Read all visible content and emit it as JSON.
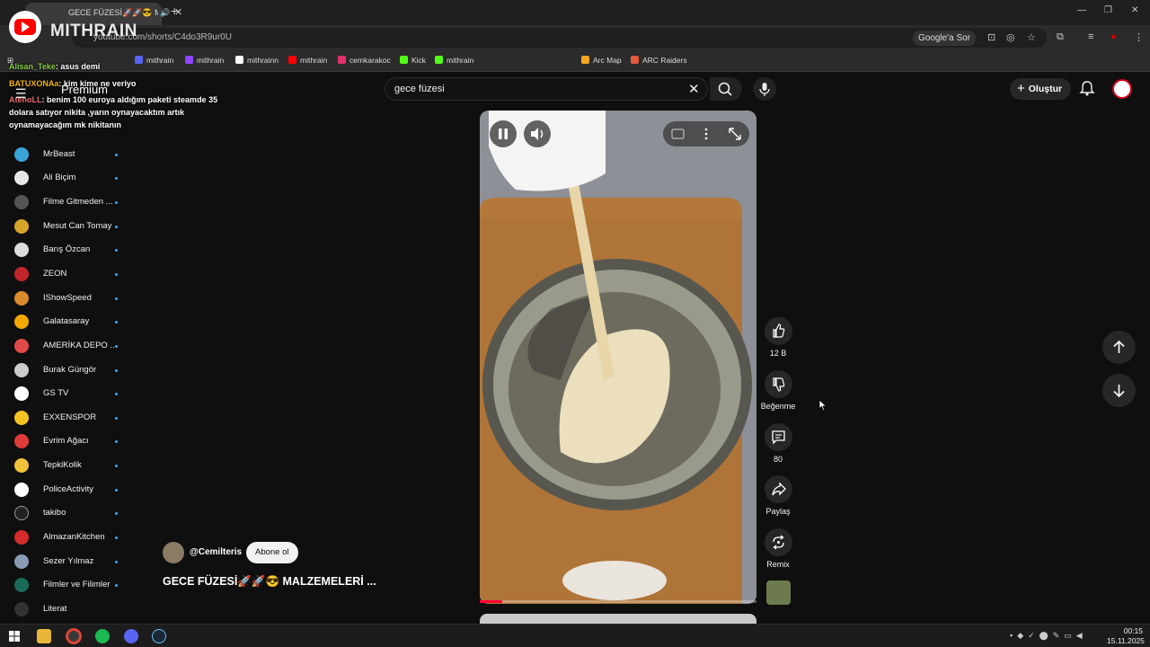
{
  "browser": {
    "tab_title": "GECE FÜZESİ🚀🚀😎 MAL",
    "url": "youtube.com/shorts/C4do3R9ur0U",
    "google_ask": "Google'a Sor",
    "bookmarks": [
      {
        "label": "mithrain",
        "color": "#5865f2"
      },
      {
        "label": "mithrain",
        "color": "#9146ff"
      },
      {
        "label": "mithrainn",
        "color": "#ffffff"
      },
      {
        "label": "mithrain",
        "color": "#ff0000"
      },
      {
        "label": "cemkarakoc",
        "color": "#e1306c"
      },
      {
        "label": "Kick",
        "color": "#53fc18"
      },
      {
        "label": "mithrain",
        "color": "#53fc18"
      },
      {
        "label": "Arc Map",
        "color": "#f5a623"
      },
      {
        "label": "ARC Raiders",
        "color": "#e25c3c"
      }
    ]
  },
  "overlay": {
    "streamer": "MITHRAIN",
    "chat": [
      {
        "user": "Alisan_Teke",
        "msg": ": asus demi"
      },
      {
        "user": "BATUXONAa",
        "msg": ": kim kime ne veriyo"
      },
      {
        "user": "AtenoLL",
        "msg": ": benim 100 euroya aldığım paketi steamde 35"
      },
      {
        "user": "",
        "msg": "dolara satıyor nikita ,yarın oynayacaktım artık"
      },
      {
        "user": "",
        "msg": "oynamayacağım mk nikitanın"
      }
    ]
  },
  "header": {
    "premium": "Premium",
    "search_value": "gece füzesi",
    "create_label": "Oluştur"
  },
  "sidebar": {
    "items": [
      {
        "label": "MrBeast",
        "color": "#3aa3d9"
      },
      {
        "label": "Ali Biçim",
        "color": "#e6e6e6"
      },
      {
        "label": "Filme Gitmeden ...",
        "color": "#555555"
      },
      {
        "label": "Mesut Can Tomay",
        "color": "#d6a52b"
      },
      {
        "label": "Barış Özcan",
        "color": "#dddddd"
      },
      {
        "label": "ZEON",
        "color": "#c0262c"
      },
      {
        "label": "IShowSpeed",
        "color": "#d98b2b"
      },
      {
        "label": "Galatasaray",
        "color": "#f2a900"
      },
      {
        "label": "AMERİKA DEPO ...",
        "color": "#e24a4a"
      },
      {
        "label": "Burak Güngör",
        "color": "#cccccc"
      },
      {
        "label": "GS TV",
        "color": "#ffffff"
      },
      {
        "label": "EXXENSPOR",
        "color": "#f3c324"
      },
      {
        "label": "Evrim Ağacı",
        "color": "#e03c3c"
      },
      {
        "label": "TepkiKolik",
        "color": "#f2c23a"
      },
      {
        "label": "PoliceActivity",
        "color": "#ffffff"
      },
      {
        "label": "takibo",
        "color": "#222222"
      },
      {
        "label": "AlmazanKitchen",
        "color": "#d42b2b"
      },
      {
        "label": "Sezer Yılmaz",
        "color": "#8a9bb5"
      },
      {
        "label": "Filmler ve Filimler",
        "color": "#1a6b5a"
      },
      {
        "label": "Literat",
        "color": "#333333"
      }
    ]
  },
  "video": {
    "progress": 0.08,
    "channel": "@Cemilteris",
    "subscribe": "Abone ol",
    "title": "GECE FÜZESİ🚀🚀😎 MALZEMELERİ ..."
  },
  "actions": {
    "likes": "12 B",
    "dislike": "Beğenme",
    "comments": "80",
    "share": "Paylaş",
    "remix": "Remix"
  },
  "taskbar": {
    "time": "00:15",
    "date": "15.11.2025"
  }
}
